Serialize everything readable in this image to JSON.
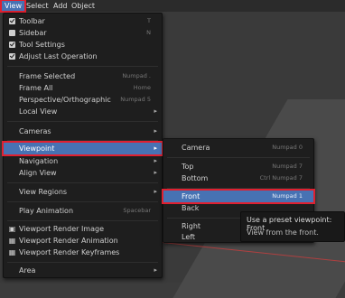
{
  "menubar": {
    "items": [
      {
        "label": "View",
        "active": true
      },
      {
        "label": "Select",
        "active": false
      },
      {
        "label": "Add",
        "active": false
      },
      {
        "label": "Object",
        "active": false
      }
    ]
  },
  "view_menu": {
    "items": [
      {
        "label": "Toolbar",
        "shortcut": "T",
        "check": true
      },
      {
        "label": "Sidebar",
        "shortcut": "N",
        "check": false
      },
      {
        "label": "Tool Settings",
        "shortcut": "",
        "check": true
      },
      {
        "label": "Adjust Last Operation",
        "shortcut": "",
        "check": true
      },
      {
        "label": "Frame Selected",
        "shortcut": "Numpad ."
      },
      {
        "label": "Frame All",
        "shortcut": "Home"
      },
      {
        "label": "Perspective/Orthographic",
        "shortcut": "Numpad 5"
      },
      {
        "label": "Local View",
        "submenu": true
      },
      {
        "label": "Cameras",
        "submenu": true
      },
      {
        "label": "Viewpoint",
        "submenu": true,
        "highlighted": true
      },
      {
        "label": "Navigation",
        "submenu": true
      },
      {
        "label": "Align View",
        "submenu": true
      },
      {
        "label": "View Regions",
        "submenu": true
      },
      {
        "label": "Play Animation",
        "shortcut": "Spacebar"
      },
      {
        "label": "Viewport Render Image",
        "icon": "render-image-icon"
      },
      {
        "label": "Viewport Render Animation",
        "icon": "render-animation-icon"
      },
      {
        "label": "Viewport Render Keyframes",
        "icon": "render-keyframes-icon"
      },
      {
        "label": "Area",
        "submenu": true
      }
    ]
  },
  "viewpoint_menu": {
    "items": [
      {
        "label": "Camera",
        "shortcut": "Numpad 0"
      },
      {
        "label": "Top",
        "shortcut": "Numpad 7"
      },
      {
        "label": "Bottom",
        "shortcut": "Ctrl Numpad 7"
      },
      {
        "label": "Front",
        "shortcut": "Numpad 1",
        "highlighted": true
      },
      {
        "label": "Back",
        "shortcut": ""
      },
      {
        "label": "Right",
        "shortcut": ""
      },
      {
        "label": "Left",
        "shortcut": ""
      }
    ]
  },
  "tooltip": {
    "title": "Use a preset viewpoint:  Front",
    "description": "View from the front."
  },
  "colors": {
    "highlight": "#4772b3",
    "annotation_red": "#e02030"
  }
}
